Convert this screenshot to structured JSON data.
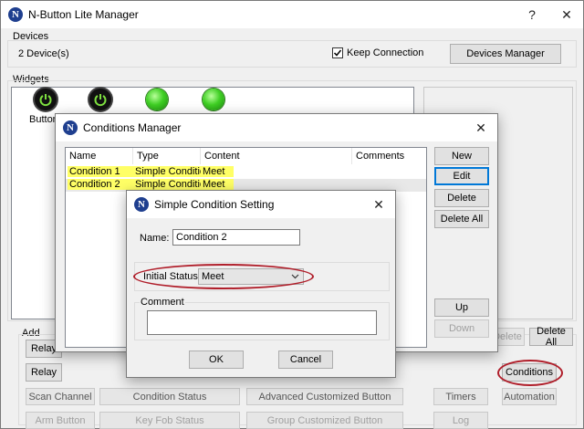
{
  "main": {
    "title": "N-Button Lite Manager",
    "help": "?",
    "close": "✕",
    "devices_label": "Devices",
    "device_count": "2 Device(s)",
    "keep_connection": "Keep Connection",
    "devices_manager": "Devices Manager",
    "widgets_label": "Widgets",
    "widget_button_label": "Button",
    "add_label": "Add",
    "btn_relay1": "Relay",
    "btn_relay2": "Relay",
    "btn_scan_channel": "Scan Channel",
    "btn_condition_status": "Condition Status",
    "btn_adv_button": "Advanced Customized Button",
    "btn_timers": "Timers",
    "btn_automation": "Automation",
    "btn_arm": "Arm Button",
    "btn_keyfob": "Key Fob Status",
    "btn_group": "Group Customized Button",
    "btn_log": "Log",
    "btn_delete": "Delete",
    "btn_delete_all": "Delete All",
    "btn_conditions": "Conditions"
  },
  "conditions_manager": {
    "title": "Conditions Manager",
    "close": "✕",
    "columns": [
      "Name",
      "Type",
      "Content",
      "Comments"
    ],
    "rows": [
      {
        "name": "Condition 1",
        "type": "Simple Condition",
        "content": "Meet",
        "comments": ""
      },
      {
        "name": "Condition 2",
        "type": "Simple Condition",
        "content": "Meet",
        "comments": ""
      }
    ],
    "btn_new": "New",
    "btn_edit": "Edit",
    "btn_delete": "Delete",
    "btn_delete_all": "Delete All",
    "btn_up": "Up",
    "btn_down": "Down"
  },
  "simple_condition": {
    "title": "Simple Condition Setting",
    "close": "✕",
    "name_label": "Name:",
    "name_value": "Condition 2",
    "initial_status_label": "Initial Status:",
    "initial_status_value": "Meet",
    "comment_label": "Comment",
    "comment_value": "",
    "ok": "OK",
    "cancel": "Cancel"
  },
  "colors": {
    "highlight": "#ffff66",
    "annotation_ring": "#b01e2a",
    "focus_blue": "#0078d7",
    "power_button": "#111111",
    "status_green": "#3fcf24"
  }
}
